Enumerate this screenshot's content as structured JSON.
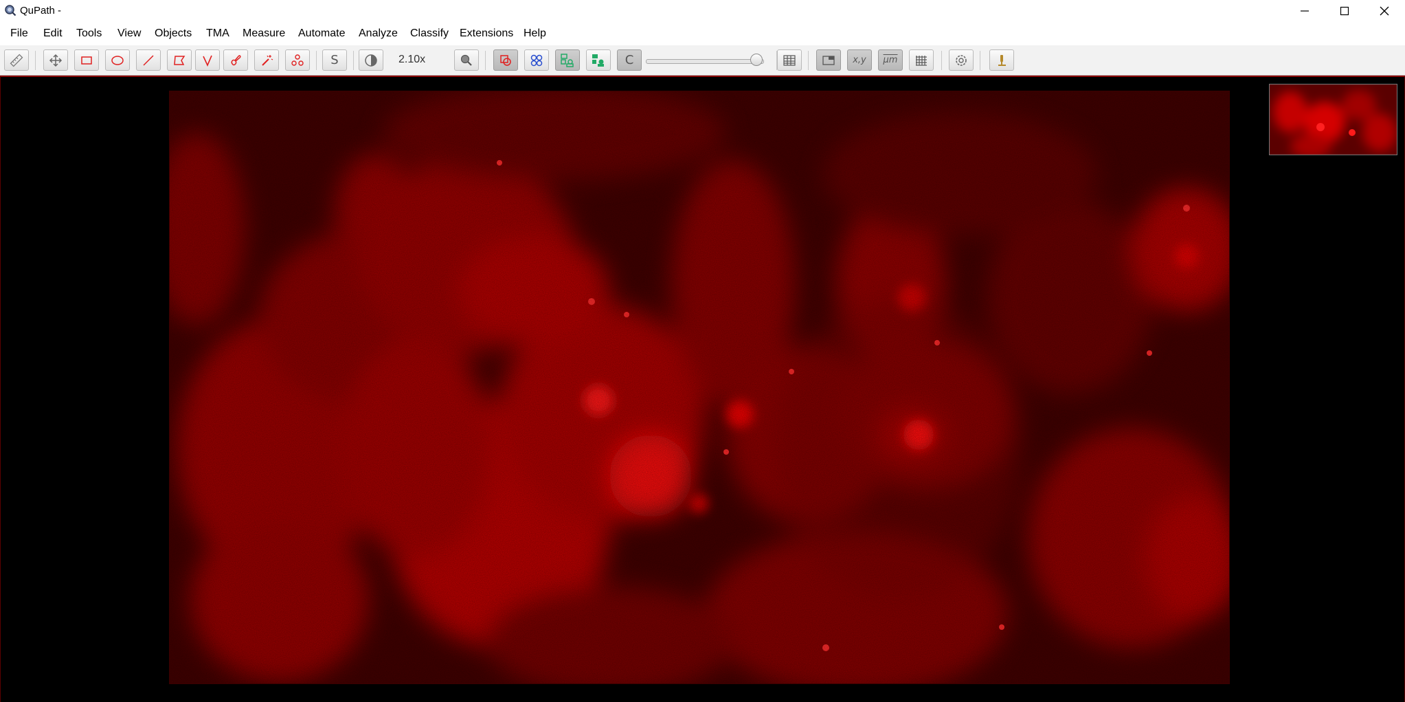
{
  "window": {
    "title": "QuPath -",
    "icon": "qupath-logo-icon",
    "controls": [
      "minimize-icon",
      "maximize-icon",
      "close-icon"
    ]
  },
  "menu": {
    "items": [
      {
        "label": "File"
      },
      {
        "label": "Edit"
      },
      {
        "label": "Tools"
      },
      {
        "label": "View"
      },
      {
        "label": "Objects"
      },
      {
        "label": "TMA"
      },
      {
        "label": "Measure"
      },
      {
        "label": "Automate"
      },
      {
        "label": "Analyze"
      },
      {
        "label": "Classify"
      },
      {
        "label": "Extensions"
      },
      {
        "label": "Help"
      }
    ]
  },
  "toolbar": {
    "tools": [
      "measure-ruler-icon",
      "move-tool-icon",
      "rectangle-tool-icon",
      "ellipse-tool-icon",
      "line-tool-icon",
      "polygon-tool-icon",
      "polyline-tool-icon",
      "brush-tool-icon",
      "wand-tool-icon",
      "points-tool-icon"
    ],
    "selection_mode_label": "S",
    "zoom_label": "2.10x",
    "cell_display_label": "C",
    "opacity_level": 1.0,
    "pixel_coords_label": "x,y",
    "units_label": "µm",
    "icon_colors": {
      "draw": "#e02020",
      "detect": "#22aa66",
      "select": "#2a4fcf",
      "microscope": "#b5892b"
    }
  },
  "viewer": {
    "channel_color": "#ff1a1a",
    "background": "#000000"
  }
}
